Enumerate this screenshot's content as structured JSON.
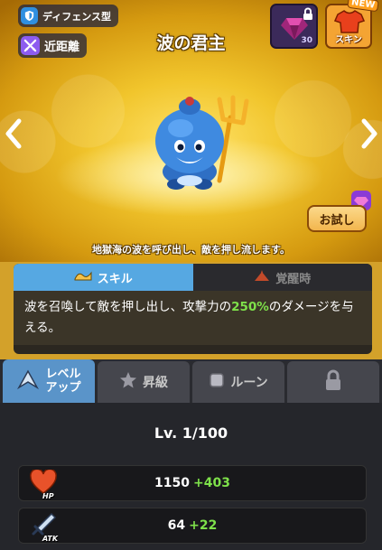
{
  "hero": {
    "type_badge": "ディフェンス型",
    "range_badge": "近距離",
    "title": "波の君主",
    "gem_count": "30",
    "skin_label": "スキン",
    "new_tag": "NEW",
    "trial_label": "お試し",
    "description": "地獄海の波を呼び出し、敵を押し流します。"
  },
  "skill": {
    "tabs": [
      {
        "label": "スキル",
        "active": true
      },
      {
        "label": "覚醒時",
        "active": false
      }
    ],
    "text_before": "波を召喚して敵を押し出し、攻撃力の",
    "highlight": "250%",
    "text_after": "のダメージを与える。"
  },
  "bottom_tabs": {
    "levelup_line1": "レベル",
    "levelup_line2": "アップ",
    "promote": "昇級",
    "rune": "ルーン"
  },
  "stats": {
    "level": "Lv. 1/100",
    "hp": {
      "value": "1150",
      "bonus": "+403",
      "tag": "HP"
    },
    "atk": {
      "value": "64",
      "bonus": "+22",
      "tag": "ATK"
    }
  },
  "colors": {
    "accent_green": "#7ee14a",
    "tab_blue": "#56a8e2",
    "banner_gold": "#f1c52c"
  }
}
